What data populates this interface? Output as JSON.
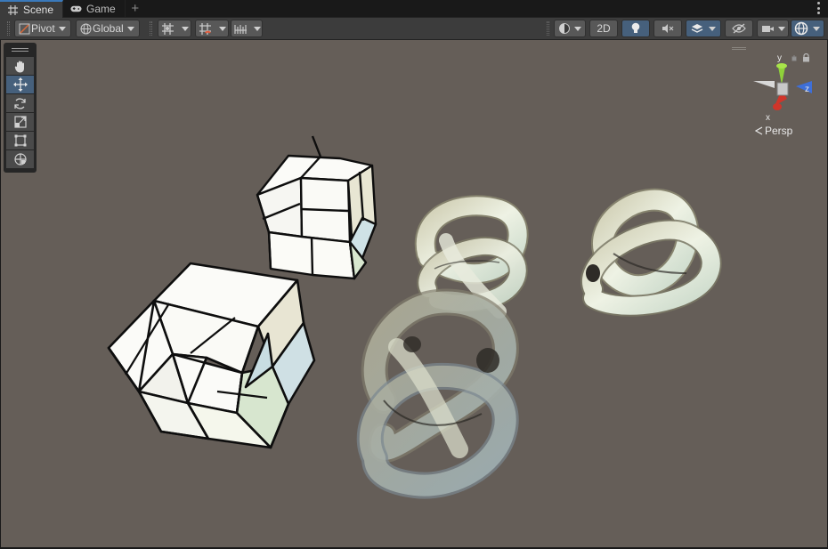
{
  "tabs": [
    {
      "label": "Scene",
      "icon": "scene-grid-icon",
      "active": true
    },
    {
      "label": "Game",
      "icon": "gamepad-icon",
      "active": false
    }
  ],
  "tab_add_label": "+",
  "toolbar": {
    "pivot_label": "Pivot",
    "global_label": "Global",
    "two_d_label": "2D"
  },
  "tools": [
    {
      "name": "hand-tool",
      "icon": "hand-icon"
    },
    {
      "name": "move-tool",
      "icon": "move-icon",
      "active": true
    },
    {
      "name": "rotate-tool",
      "icon": "rotate-icon"
    },
    {
      "name": "scale-tool",
      "icon": "scale-icon"
    },
    {
      "name": "rect-tool",
      "icon": "rect-icon"
    },
    {
      "name": "transform-tool",
      "icon": "transform-icon"
    }
  ],
  "gizmo": {
    "y_label": "y",
    "z_label": "z",
    "x_label": "x",
    "projection_label": "Persp"
  },
  "colors": {
    "viewport_bg": "#655e58",
    "accent": "#46607c",
    "x_axis": "#d0352a",
    "y_axis": "#8fd23a",
    "z_axis": "#3e6fd8"
  }
}
